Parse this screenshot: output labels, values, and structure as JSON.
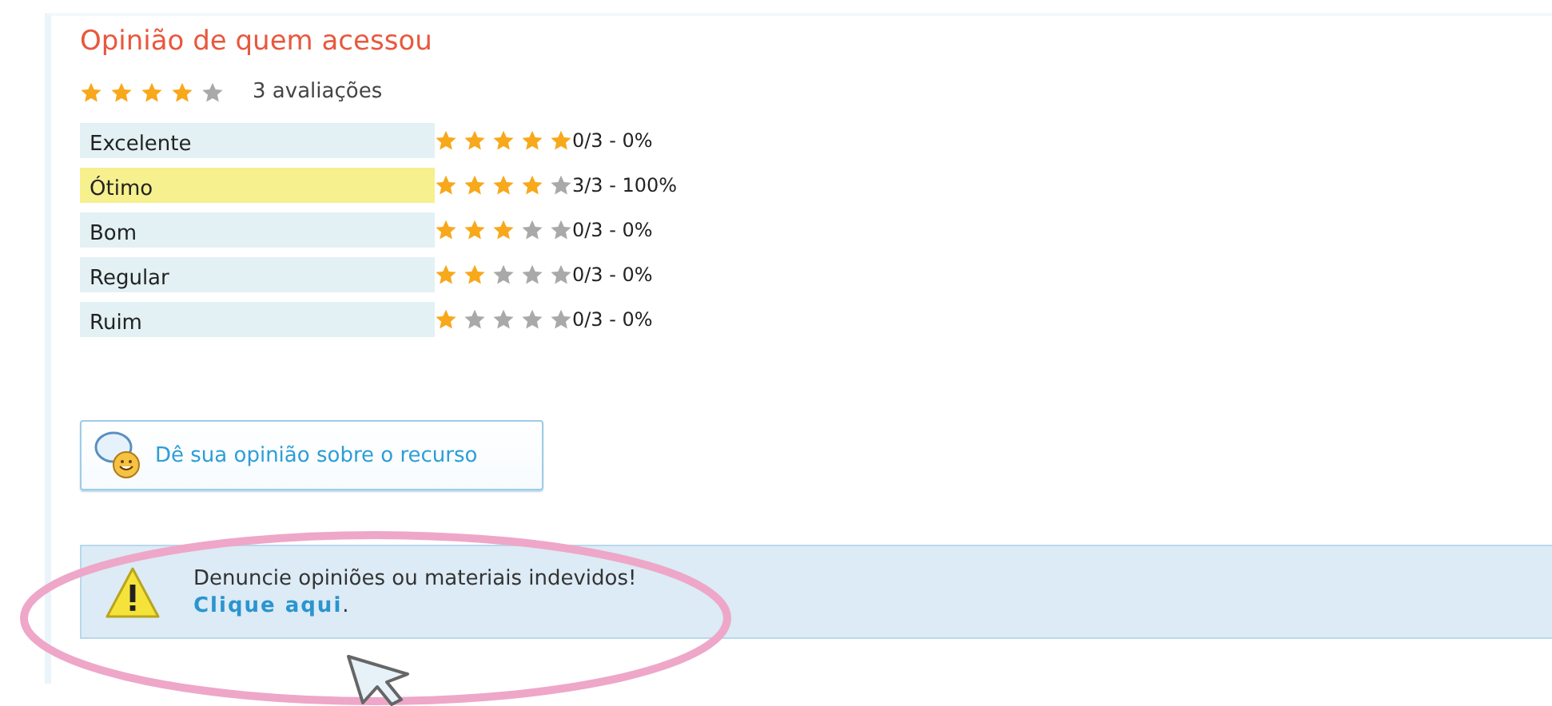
{
  "title": "Opinião de quem acessou",
  "summary": {
    "stars": 4,
    "count": "3 avaliações"
  },
  "ratings": [
    {
      "label": "Excelente",
      "stars": 5,
      "result": "0/3 - 0%",
      "selected": false
    },
    {
      "label": "Ótimo",
      "stars": 4,
      "result": "3/3 - 100%",
      "selected": true
    },
    {
      "label": "Bom",
      "stars": 3,
      "result": "0/3 - 0%",
      "selected": false
    },
    {
      "label": "Regular",
      "stars": 2,
      "result": "0/3 - 0%",
      "selected": false
    },
    {
      "label": "Ruim",
      "stars": 1,
      "result": "0/3 - 0%",
      "selected": false
    }
  ],
  "opinion_button": {
    "label": "Dê sua opinião sobre o recurso"
  },
  "report": {
    "message": "Denuncie opiniões ou materiais indevidos!",
    "link": "Clique aqui",
    "after_link": "."
  }
}
